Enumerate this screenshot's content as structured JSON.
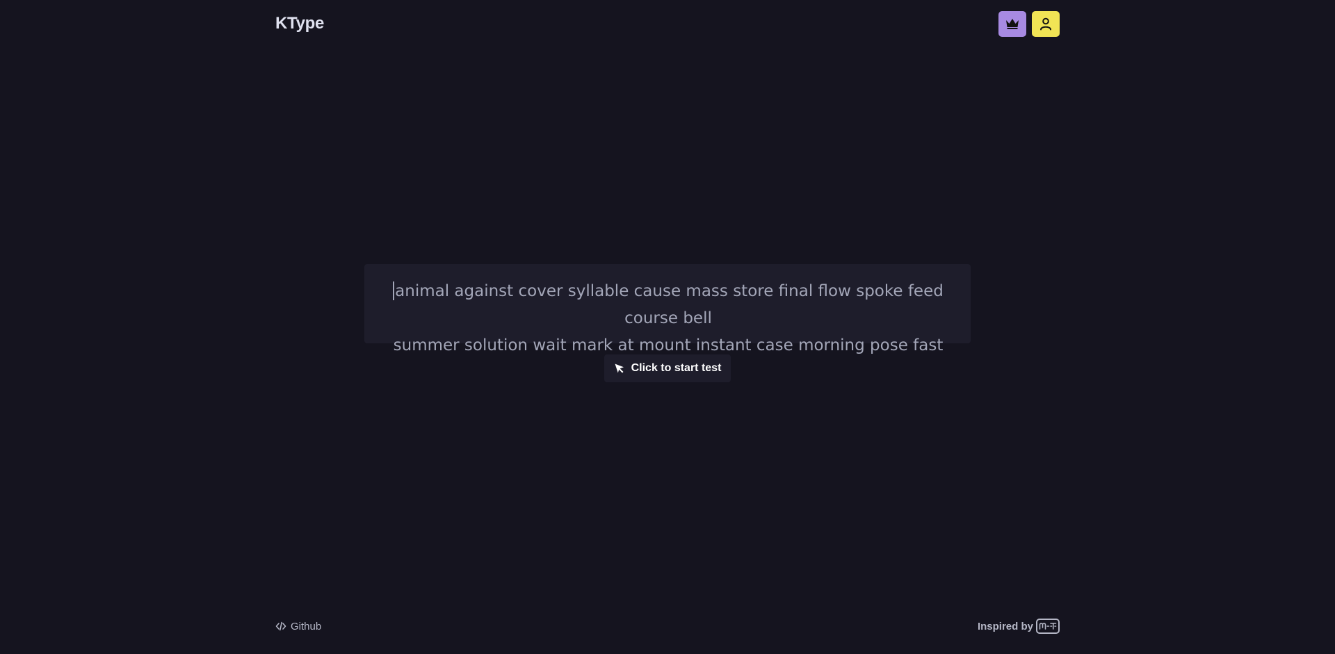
{
  "header": {
    "logo": "KType",
    "premium_icon": "crown-icon",
    "profile_icon": "user-icon",
    "colors": {
      "premium_bg": "#a78ae2",
      "profile_bg": "#f1e455"
    }
  },
  "typing": {
    "line1": "animal against cover syllable cause mass store final flow spoke feed course bell",
    "line2": "summer solution wait mark at mount instant case morning pose fast science"
  },
  "start": {
    "icon": "cursor-icon",
    "label": "Click to start test"
  },
  "footer": {
    "github_icon": "code-icon",
    "github_label": "Github",
    "inspired_label": "Inspired by",
    "inspired_icon": "monkeytype-logo-icon"
  },
  "colors": {
    "background": "#15141f",
    "surface": "#1e1d2b",
    "text_muted": "#a3a6b8"
  }
}
